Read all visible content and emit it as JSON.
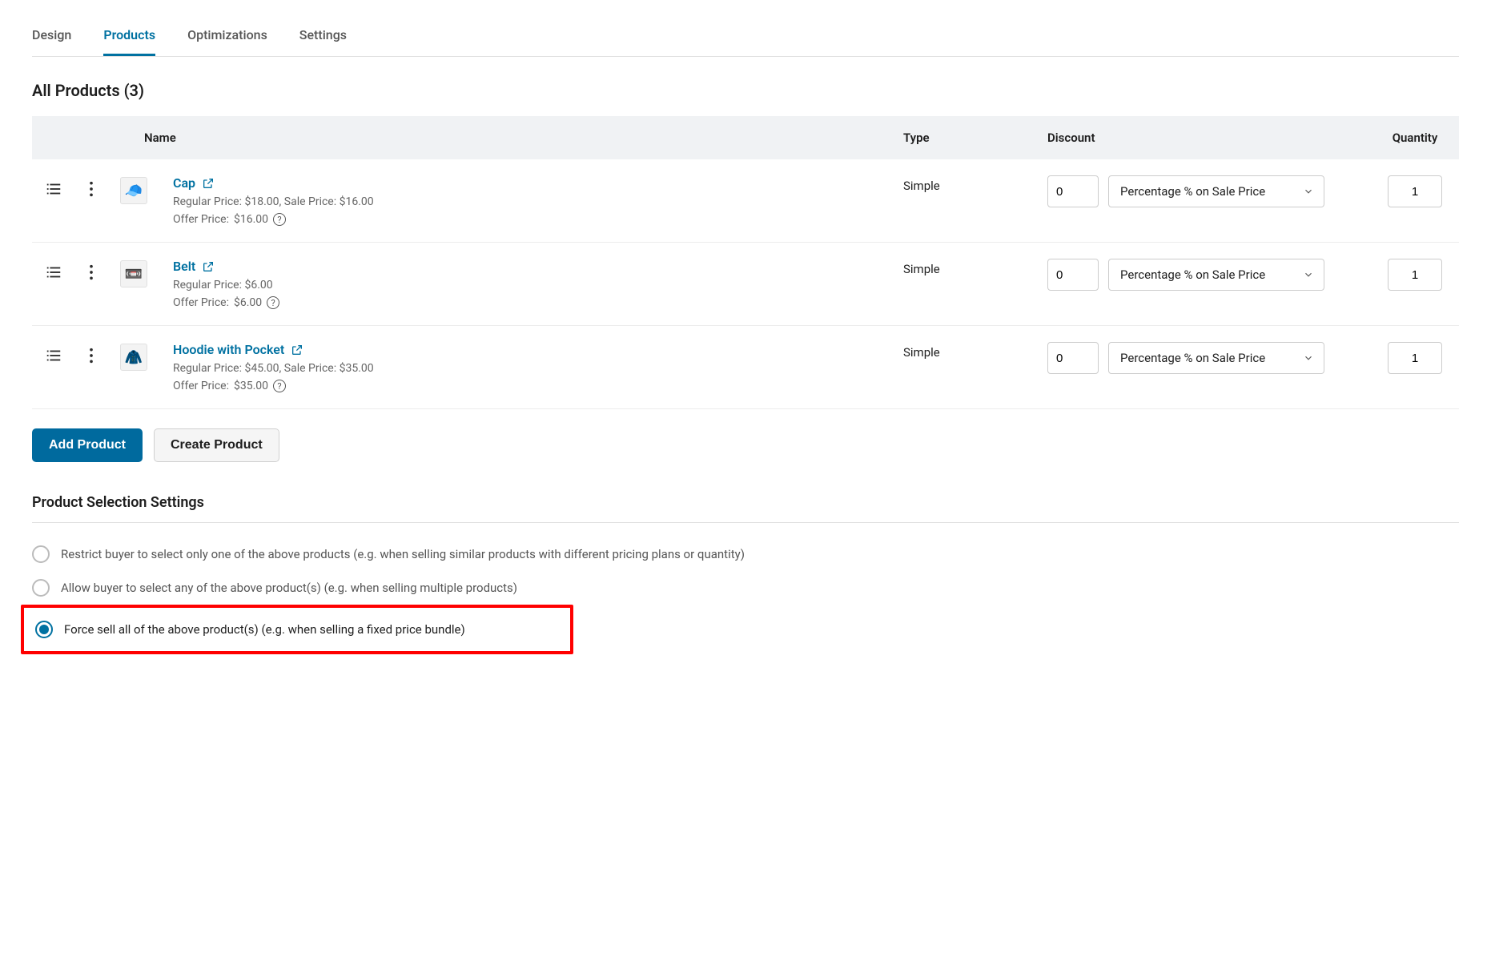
{
  "tabs": [
    {
      "label": "Design",
      "active": false
    },
    {
      "label": "Products",
      "active": true
    },
    {
      "label": "Optimizations",
      "active": false
    },
    {
      "label": "Settings",
      "active": false
    }
  ],
  "section_title": "All Products (3)",
  "columns": {
    "name": "Name",
    "type": "Type",
    "discount": "Discount",
    "quantity": "Quantity"
  },
  "price_labels": {
    "regular": "Regular Price:",
    "sale": "Sale Price:",
    "offer": "Offer Price:"
  },
  "products": [
    {
      "name": "Cap",
      "thumb_emoji": "🧢",
      "type": "Simple",
      "regular_price": "$18.00",
      "sale_price": "$16.00",
      "offer_price": "$16.00",
      "discount_value": "0",
      "discount_type": "Percentage % on Sale Price",
      "quantity": "1",
      "has_sale": true
    },
    {
      "name": "Belt",
      "thumb_emoji": "📼",
      "type": "Simple",
      "regular_price": "$6.00",
      "sale_price": "",
      "offer_price": "$6.00",
      "discount_value": "0",
      "discount_type": "Percentage % on Sale Price",
      "quantity": "1",
      "has_sale": false
    },
    {
      "name": "Hoodie with Pocket",
      "thumb_emoji": "🧥",
      "type": "Simple",
      "regular_price": "$45.00",
      "sale_price": "$35.00",
      "offer_price": "$35.00",
      "discount_value": "0",
      "discount_type": "Percentage % on Sale Price",
      "quantity": "1",
      "has_sale": true
    }
  ],
  "buttons": {
    "add": "Add Product",
    "create": "Create Product"
  },
  "settings": {
    "title": "Product Selection Settings",
    "options": [
      {
        "label": "Restrict buyer to select only one of the above products (e.g. when selling similar products with different pricing plans or quantity)",
        "selected": false,
        "highlight": false
      },
      {
        "label": "Allow buyer to select any of the above product(s) (e.g. when selling multiple products)",
        "selected": false,
        "highlight": false
      },
      {
        "label": "Force sell all of the above product(s) (e.g. when selling a fixed price bundle)",
        "selected": true,
        "highlight": true
      }
    ]
  }
}
